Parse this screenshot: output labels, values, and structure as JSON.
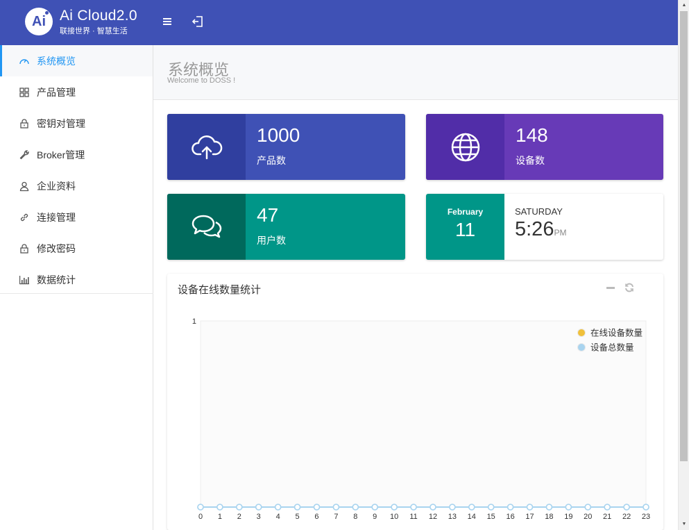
{
  "header": {
    "logo_text": "Ai",
    "brand_title": "Ai Cloud2.0",
    "brand_subtitle": "联接世界 · 智慧生活"
  },
  "sidebar": {
    "items": [
      {
        "label": "系统概览",
        "icon": "dashboard-gauge-icon",
        "active": true
      },
      {
        "label": "产品管理",
        "icon": "grid-icon"
      },
      {
        "label": "密钥对管理",
        "icon": "lock-icon"
      },
      {
        "label": "Broker管理",
        "icon": "wrench-icon"
      },
      {
        "label": "企业资料",
        "icon": "user-icon"
      },
      {
        "label": "连接管理",
        "icon": "link-icon"
      },
      {
        "label": "修改密码",
        "icon": "lock-icon"
      },
      {
        "label": "数据统计",
        "icon": "bar-chart-icon"
      }
    ]
  },
  "page": {
    "title": "系统概览",
    "subtitle": "Welcome to DOSS !"
  },
  "stats": [
    {
      "value": "1000",
      "label": "产品数",
      "icon": "cloud-upload-icon",
      "color": "#3f51b5",
      "icon_bg": "#303f9f"
    },
    {
      "value": "148",
      "label": "设备数",
      "icon": "globe-icon",
      "color": "#673ab7",
      "icon_bg": "#512da8"
    },
    {
      "value": "47",
      "label": "用户数",
      "icon": "chat-bubbles-icon",
      "color": "#009688",
      "icon_bg": "#00695c"
    }
  ],
  "date_card": {
    "month": "February",
    "day": "11",
    "weekday": "SATURDAY",
    "time": "5:26",
    "ampm": "PM"
  },
  "chart_panel": {
    "title": "设备在线数量统计"
  },
  "chart_data": {
    "type": "line",
    "x": [
      0,
      1,
      2,
      3,
      4,
      5,
      6,
      7,
      8,
      9,
      10,
      11,
      12,
      13,
      14,
      15,
      16,
      17,
      18,
      19,
      20,
      21,
      22,
      23
    ],
    "ylim": [
      0,
      1
    ],
    "y_ticks": [
      "1"
    ],
    "legend_position": "top-right",
    "series": [
      {
        "name": "在线设备数量",
        "color": "#f0c03a",
        "values": [
          0,
          0,
          0,
          0,
          0,
          0,
          0,
          0,
          0,
          0,
          0,
          0,
          0,
          0,
          0,
          0,
          0,
          0,
          0,
          0,
          0,
          0,
          0,
          0
        ]
      },
      {
        "name": "设备总数量",
        "color": "#a9d4ef",
        "values": [
          0,
          0,
          0,
          0,
          0,
          0,
          0,
          0,
          0,
          0,
          0,
          0,
          0,
          0,
          0,
          0,
          0,
          0,
          0,
          0,
          0,
          0,
          0,
          0
        ]
      }
    ]
  }
}
